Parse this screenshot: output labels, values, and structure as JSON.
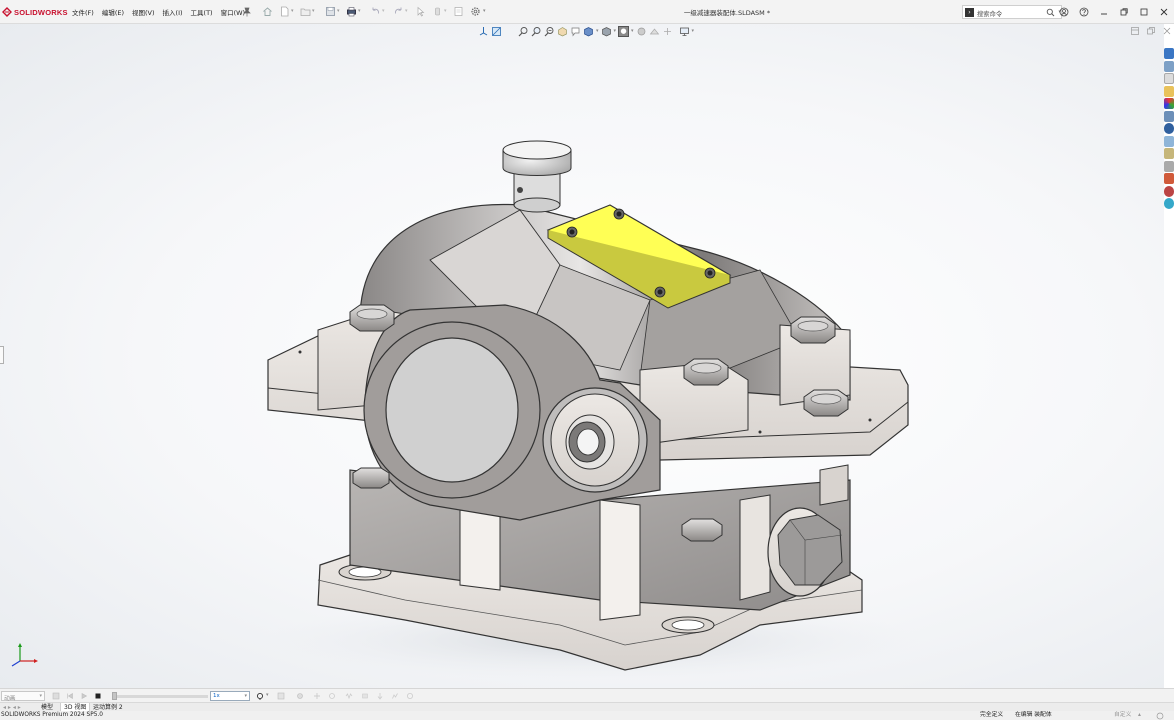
{
  "app": {
    "brand": "SOLIDWORKS",
    "document_title": "一级减速器装配体.SLDASM *",
    "colors": {
      "brand_red": "#c8102e",
      "part_yellow": "#ffff55",
      "housing_grey": "#9b9898",
      "highlight": "#0a64c8"
    }
  },
  "menu": {
    "items": [
      "文件(F)",
      "编辑(E)",
      "视图(V)",
      "插入(I)",
      "工具(T)",
      "窗口(W)"
    ],
    "pin_icon": "pushpin-icon"
  },
  "quick_access": {
    "icons": [
      "home-icon",
      "new-document-icon",
      "open-folder-icon",
      "save-icon",
      "print-icon",
      "undo-icon",
      "redo-icon",
      "select-icon",
      "rebuild-icon",
      "options-icon"
    ]
  },
  "search": {
    "placeholder": "搜索命令",
    "icon": "search-icon",
    "command_icon": "command-prompt-icon"
  },
  "window_controls": {
    "icons": [
      "account-icon",
      "help-icon",
      "minimize-icon",
      "restore-icon",
      "maximize-icon",
      "close-icon"
    ]
  },
  "heads_up_toolbar": {
    "icons": [
      "view-orientation-icon",
      "section-icon",
      "zoom-to-fit-icon",
      "zoom-area-icon",
      "previous-view-icon",
      "section-view-icon",
      "dynamic-annotation-icon",
      "view-orientation-cube-icon",
      "display-style-icon",
      "hide-show-icon",
      "edit-appearance-icon",
      "apply-scene-icon",
      "view-settings-icon",
      "display-monitor-icon"
    ]
  },
  "task_pane": {
    "tabs": [
      "solidworks-resources-icon",
      "design-library-icon",
      "file-explorer-icon",
      "view-palette-icon",
      "appearances-icon",
      "custom-properties-icon",
      "3dexperience-icon",
      "forum-icon",
      "toolbox-icon",
      "pdm-icon",
      "motion-icon",
      "help-cube-icon"
    ]
  },
  "motion": {
    "study_type": "动画",
    "playback_value": "1x",
    "controls": [
      "calculate-icon",
      "play-from-start-icon",
      "play-icon",
      "stop-icon"
    ]
  },
  "tabs": [
    {
      "label": "模型",
      "active": false
    },
    {
      "label": "3D 视图",
      "active": true
    },
    {
      "label": "运动算例 2",
      "active": false
    }
  ],
  "status": {
    "product": "SOLIDWORKS Premium 2024 SP5.0",
    "definition": "完全定义",
    "editing": "在编辑 装配体",
    "custom": "自定义"
  }
}
